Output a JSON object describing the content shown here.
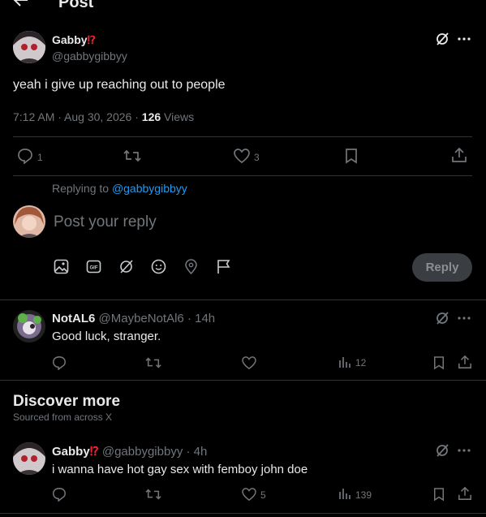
{
  "header": {
    "title": "Post"
  },
  "main_post": {
    "author_name": "Gabby",
    "author_badge": "⁉",
    "handle": "@gabbygibbyy",
    "text": "yeah i give up reaching out to people",
    "time": "7:12 AM · Aug 30, 2026 · ",
    "views": "126",
    "views_label": " Views",
    "stats": {
      "replies": "1",
      "likes": "3"
    }
  },
  "reply_box": {
    "replying_to_label": "Replying to ",
    "replying_to_handle": "@gabbygibbyy",
    "placeholder": "Post your reply",
    "reply_button": "Reply"
  },
  "reply_1": {
    "author_name": "NotAL6",
    "handle_time": "@MaybeNotAl6 · 14h",
    "text": "Good luck, stranger.",
    "views": "12"
  },
  "discover": {
    "title": "Discover more",
    "subtitle": "Sourced from across X"
  },
  "discover_post": {
    "author_name": "Gabby",
    "author_badge": "⁉",
    "handle_time": "@gabbygibbyy · 4h",
    "text": "i wanna have hot gay sex with femboy john doe",
    "likes": "5",
    "views": "139"
  },
  "colors": {
    "link": "#1d9bf0",
    "badge": "#f4212e",
    "muted": "#71767b"
  }
}
